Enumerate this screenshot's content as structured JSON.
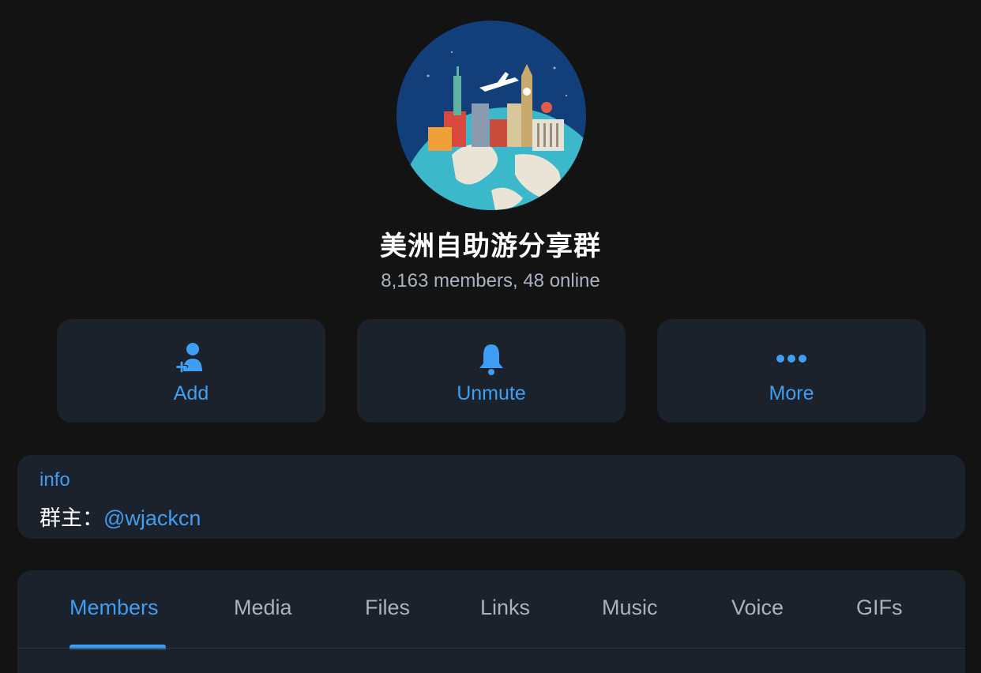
{
  "group": {
    "title": "美洲自助游分享群",
    "subtitle": "8,163 members, 48 online"
  },
  "actions": {
    "add": {
      "label": "Add",
      "icon": "add-member-icon"
    },
    "unmute": {
      "label": "Unmute",
      "icon": "bell-icon"
    },
    "more": {
      "label": "More",
      "icon": "more-dots-icon"
    }
  },
  "info": {
    "heading": "info",
    "prefix": "群主：",
    "link": "@wjackcn"
  },
  "tabs": [
    {
      "label": "Members",
      "active": true
    },
    {
      "label": "Media"
    },
    {
      "label": "Files"
    },
    {
      "label": "Links"
    },
    {
      "label": "Music"
    },
    {
      "label": "Voice"
    },
    {
      "label": "GIFs"
    }
  ],
  "colors": {
    "background": "#131313",
    "card": "#1b222b",
    "accent": "#3e9ef3",
    "muted": "#a8b3bf"
  }
}
